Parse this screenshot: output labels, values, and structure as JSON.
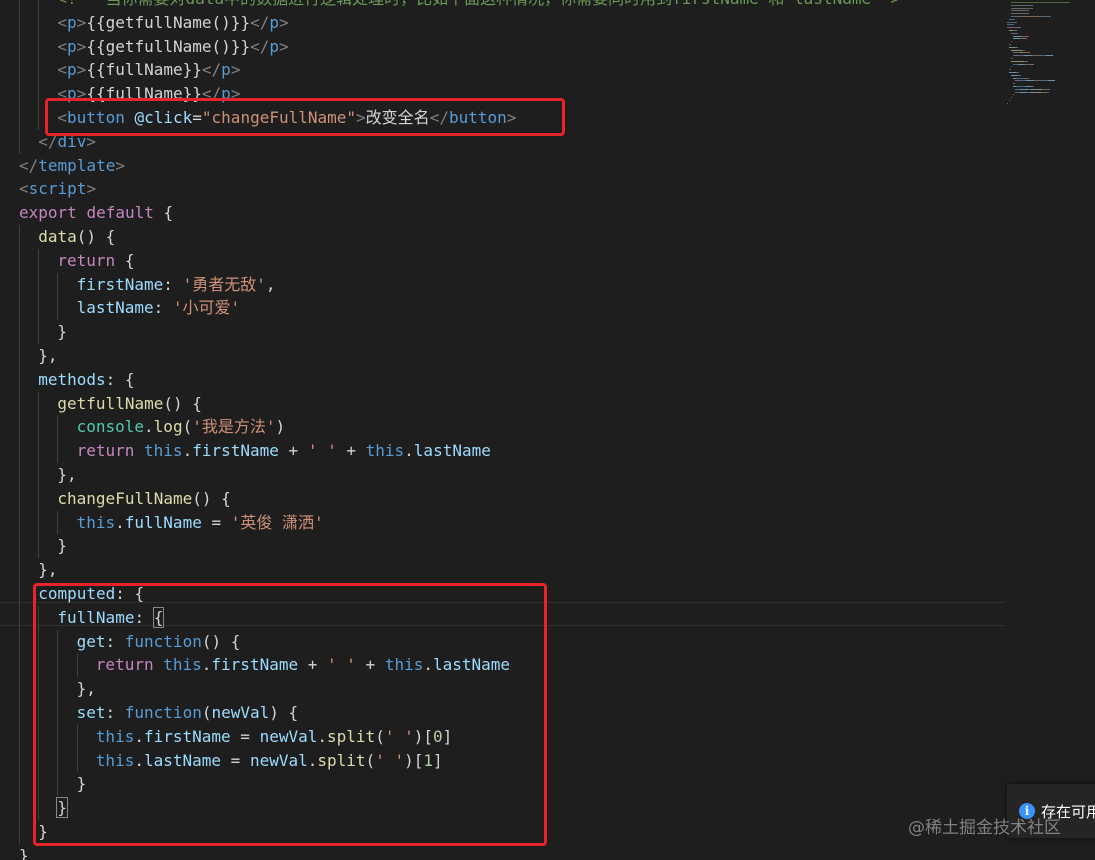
{
  "editor": {
    "lines": [
      {
        "indent": 2,
        "tokens": [
          [
            "c-comment",
            "<!-- 当你需要对data中的数据进行逻辑处理时，比如下面这种情况，你需要同时用到firstName 和 lastName-->"
          ]
        ]
      },
      {
        "indent": 2,
        "tokens": [
          [
            "c-punct",
            "<"
          ],
          [
            "c-tag",
            "p"
          ],
          [
            "c-punct",
            ">"
          ],
          [
            "c-text",
            "{{getfullName()}}"
          ],
          [
            "c-punct",
            "</"
          ],
          [
            "c-tag",
            "p"
          ],
          [
            "c-punct",
            ">"
          ]
        ]
      },
      {
        "indent": 2,
        "tokens": [
          [
            "c-punct",
            "<"
          ],
          [
            "c-tag",
            "p"
          ],
          [
            "c-punct",
            ">"
          ],
          [
            "c-text",
            "{{getfullName()}}"
          ],
          [
            "c-punct",
            "</"
          ],
          [
            "c-tag",
            "p"
          ],
          [
            "c-punct",
            ">"
          ]
        ]
      },
      {
        "indent": 2,
        "tokens": [
          [
            "c-punct",
            "<"
          ],
          [
            "c-tag",
            "p"
          ],
          [
            "c-punct",
            ">"
          ],
          [
            "c-text",
            "{{fullName}}"
          ],
          [
            "c-punct",
            "</"
          ],
          [
            "c-tag",
            "p"
          ],
          [
            "c-punct",
            ">"
          ]
        ]
      },
      {
        "indent": 2,
        "tokens": [
          [
            "c-punct",
            "<"
          ],
          [
            "c-tag",
            "p"
          ],
          [
            "c-punct",
            ">"
          ],
          [
            "c-text",
            "{{fullName}}"
          ],
          [
            "c-punct",
            "</"
          ],
          [
            "c-tag",
            "p"
          ],
          [
            "c-punct",
            ">"
          ]
        ]
      },
      {
        "indent": 2,
        "tokens": [
          [
            "c-punct",
            "<"
          ],
          [
            "c-tag",
            "button"
          ],
          [
            "c-text",
            " "
          ],
          [
            "c-attr",
            "@click"
          ],
          [
            "c-text",
            "="
          ],
          [
            "c-str",
            "\"changeFullName\""
          ],
          [
            "c-punct",
            ">"
          ],
          [
            "c-text",
            "改变全名"
          ],
          [
            "c-punct",
            "</"
          ],
          [
            "c-tag",
            "button"
          ],
          [
            "c-punct",
            ">"
          ]
        ]
      },
      {
        "indent": 1,
        "tokens": [
          [
            "c-punct",
            "</"
          ],
          [
            "c-tag",
            "div"
          ],
          [
            "c-punct",
            ">"
          ]
        ]
      },
      {
        "indent": 0,
        "tokens": [
          [
            "c-punct",
            "</"
          ],
          [
            "c-tag",
            "template"
          ],
          [
            "c-punct",
            ">"
          ]
        ]
      },
      {
        "indent": 0,
        "tokens": [
          [
            "c-punct",
            "<"
          ],
          [
            "c-tag",
            "script"
          ],
          [
            "c-punct",
            ">"
          ]
        ]
      },
      {
        "indent": 0,
        "tokens": [
          [
            "c-ctrl",
            "export"
          ],
          [
            "c-text",
            " "
          ],
          [
            "c-ctrl",
            "default"
          ],
          [
            "c-text",
            " {"
          ]
        ]
      },
      {
        "indent": 1,
        "tokens": [
          [
            "c-fn",
            "data"
          ],
          [
            "c-text",
            "() {"
          ]
        ]
      },
      {
        "indent": 2,
        "tokens": [
          [
            "c-ctrl",
            "return"
          ],
          [
            "c-text",
            " {"
          ]
        ]
      },
      {
        "indent": 3,
        "tokens": [
          [
            "c-prop",
            "firstName"
          ],
          [
            "c-text",
            ": "
          ],
          [
            "c-str",
            "'勇者无敌'"
          ],
          [
            "c-text",
            ","
          ]
        ]
      },
      {
        "indent": 3,
        "tokens": [
          [
            "c-prop",
            "lastName"
          ],
          [
            "c-text",
            ": "
          ],
          [
            "c-str",
            "'小可爱'"
          ]
        ]
      },
      {
        "indent": 2,
        "tokens": [
          [
            "c-text",
            "}"
          ]
        ]
      },
      {
        "indent": 1,
        "tokens": [
          [
            "c-text",
            "},"
          ]
        ]
      },
      {
        "indent": 1,
        "tokens": [
          [
            "c-prop",
            "methods"
          ],
          [
            "c-text",
            ": {"
          ]
        ]
      },
      {
        "indent": 2,
        "tokens": [
          [
            "c-fn",
            "getfullName"
          ],
          [
            "c-text",
            "() {"
          ]
        ]
      },
      {
        "indent": 3,
        "tokens": [
          [
            "c-var",
            "console"
          ],
          [
            "c-text",
            "."
          ],
          [
            "c-fn",
            "log"
          ],
          [
            "c-text",
            "("
          ],
          [
            "c-str",
            "'我是方法'"
          ],
          [
            "c-text",
            ")"
          ]
        ]
      },
      {
        "indent": 3,
        "tokens": [
          [
            "c-ctrl",
            "return"
          ],
          [
            "c-text",
            " "
          ],
          [
            "c-kw",
            "this"
          ],
          [
            "c-text",
            "."
          ],
          [
            "c-prop",
            "firstName"
          ],
          [
            "c-text",
            " + "
          ],
          [
            "c-str",
            "' '"
          ],
          [
            "c-text",
            " + "
          ],
          [
            "c-kw",
            "this"
          ],
          [
            "c-text",
            "."
          ],
          [
            "c-prop",
            "lastName"
          ]
        ]
      },
      {
        "indent": 2,
        "tokens": [
          [
            "c-text",
            "},"
          ]
        ]
      },
      {
        "indent": 2,
        "tokens": [
          [
            "c-fn",
            "changeFullName"
          ],
          [
            "c-text",
            "() {"
          ]
        ]
      },
      {
        "indent": 3,
        "tokens": [
          [
            "c-kw",
            "this"
          ],
          [
            "c-text",
            "."
          ],
          [
            "c-prop",
            "fullName"
          ],
          [
            "c-text",
            " = "
          ],
          [
            "c-str",
            "'英俊 潇洒'"
          ]
        ]
      },
      {
        "indent": 2,
        "tokens": [
          [
            "c-text",
            "}"
          ]
        ]
      },
      {
        "indent": 1,
        "tokens": [
          [
            "c-text",
            "},"
          ]
        ]
      },
      {
        "indent": 1,
        "tokens": [
          [
            "c-prop",
            "computed"
          ],
          [
            "c-text",
            ": {"
          ]
        ]
      },
      {
        "indent": 2,
        "tokens": [
          [
            "c-prop",
            "fullName"
          ],
          [
            "c-text",
            ": "
          ],
          [
            "c-text bracket-box",
            "{"
          ]
        ]
      },
      {
        "indent": 3,
        "tokens": [
          [
            "c-prop",
            "get"
          ],
          [
            "c-text",
            ": "
          ],
          [
            "c-kw",
            "function"
          ],
          [
            "c-text",
            "() {"
          ]
        ]
      },
      {
        "indent": 4,
        "tokens": [
          [
            "c-ctrl",
            "return"
          ],
          [
            "c-text",
            " "
          ],
          [
            "c-kw",
            "this"
          ],
          [
            "c-text",
            "."
          ],
          [
            "c-prop",
            "firstName"
          ],
          [
            "c-text",
            " + "
          ],
          [
            "c-str",
            "' '"
          ],
          [
            "c-text",
            " + "
          ],
          [
            "c-kw",
            "this"
          ],
          [
            "c-text",
            "."
          ],
          [
            "c-prop",
            "lastName"
          ]
        ]
      },
      {
        "indent": 3,
        "tokens": [
          [
            "c-text",
            "},"
          ]
        ]
      },
      {
        "indent": 3,
        "tokens": [
          [
            "c-prop",
            "set"
          ],
          [
            "c-text",
            ": "
          ],
          [
            "c-kw",
            "function"
          ],
          [
            "c-text",
            "("
          ],
          [
            "c-prop",
            "newVal"
          ],
          [
            "c-text",
            ") {"
          ]
        ]
      },
      {
        "indent": 4,
        "tokens": [
          [
            "c-kw",
            "this"
          ],
          [
            "c-text",
            "."
          ],
          [
            "c-prop",
            "firstName"
          ],
          [
            "c-text",
            " = "
          ],
          [
            "c-prop",
            "newVal"
          ],
          [
            "c-text",
            "."
          ],
          [
            "c-fn",
            "split"
          ],
          [
            "c-text",
            "("
          ],
          [
            "c-str",
            "' '"
          ],
          [
            "c-text",
            ")["
          ],
          [
            "c-num",
            "0"
          ],
          [
            "c-text",
            "]"
          ]
        ]
      },
      {
        "indent": 4,
        "tokens": [
          [
            "c-kw",
            "this"
          ],
          [
            "c-text",
            "."
          ],
          [
            "c-prop",
            "lastName"
          ],
          [
            "c-text",
            " = "
          ],
          [
            "c-prop",
            "newVal"
          ],
          [
            "c-text",
            "."
          ],
          [
            "c-fn",
            "split"
          ],
          [
            "c-text",
            "("
          ],
          [
            "c-str",
            "' '"
          ],
          [
            "c-text",
            ")["
          ],
          [
            "c-num",
            "1"
          ],
          [
            "c-text",
            "]"
          ]
        ]
      },
      {
        "indent": 3,
        "tokens": [
          [
            "c-text",
            "}"
          ]
        ]
      },
      {
        "indent": 2,
        "tokens": [
          [
            "c-text bracket-box",
            "}"
          ]
        ]
      },
      {
        "indent": 1,
        "tokens": [
          [
            "c-text",
            "}"
          ]
        ]
      },
      {
        "indent": 0,
        "tokens": [
          [
            "c-text",
            "}"
          ]
        ]
      }
    ]
  },
  "notification": {
    "icon": "info-icon",
    "text": "存在可用"
  },
  "watermark": {
    "text": "@稀土掘金技术社区"
  },
  "colors": {
    "highlight": "#e8232a",
    "background": "#1e1e1e"
  }
}
